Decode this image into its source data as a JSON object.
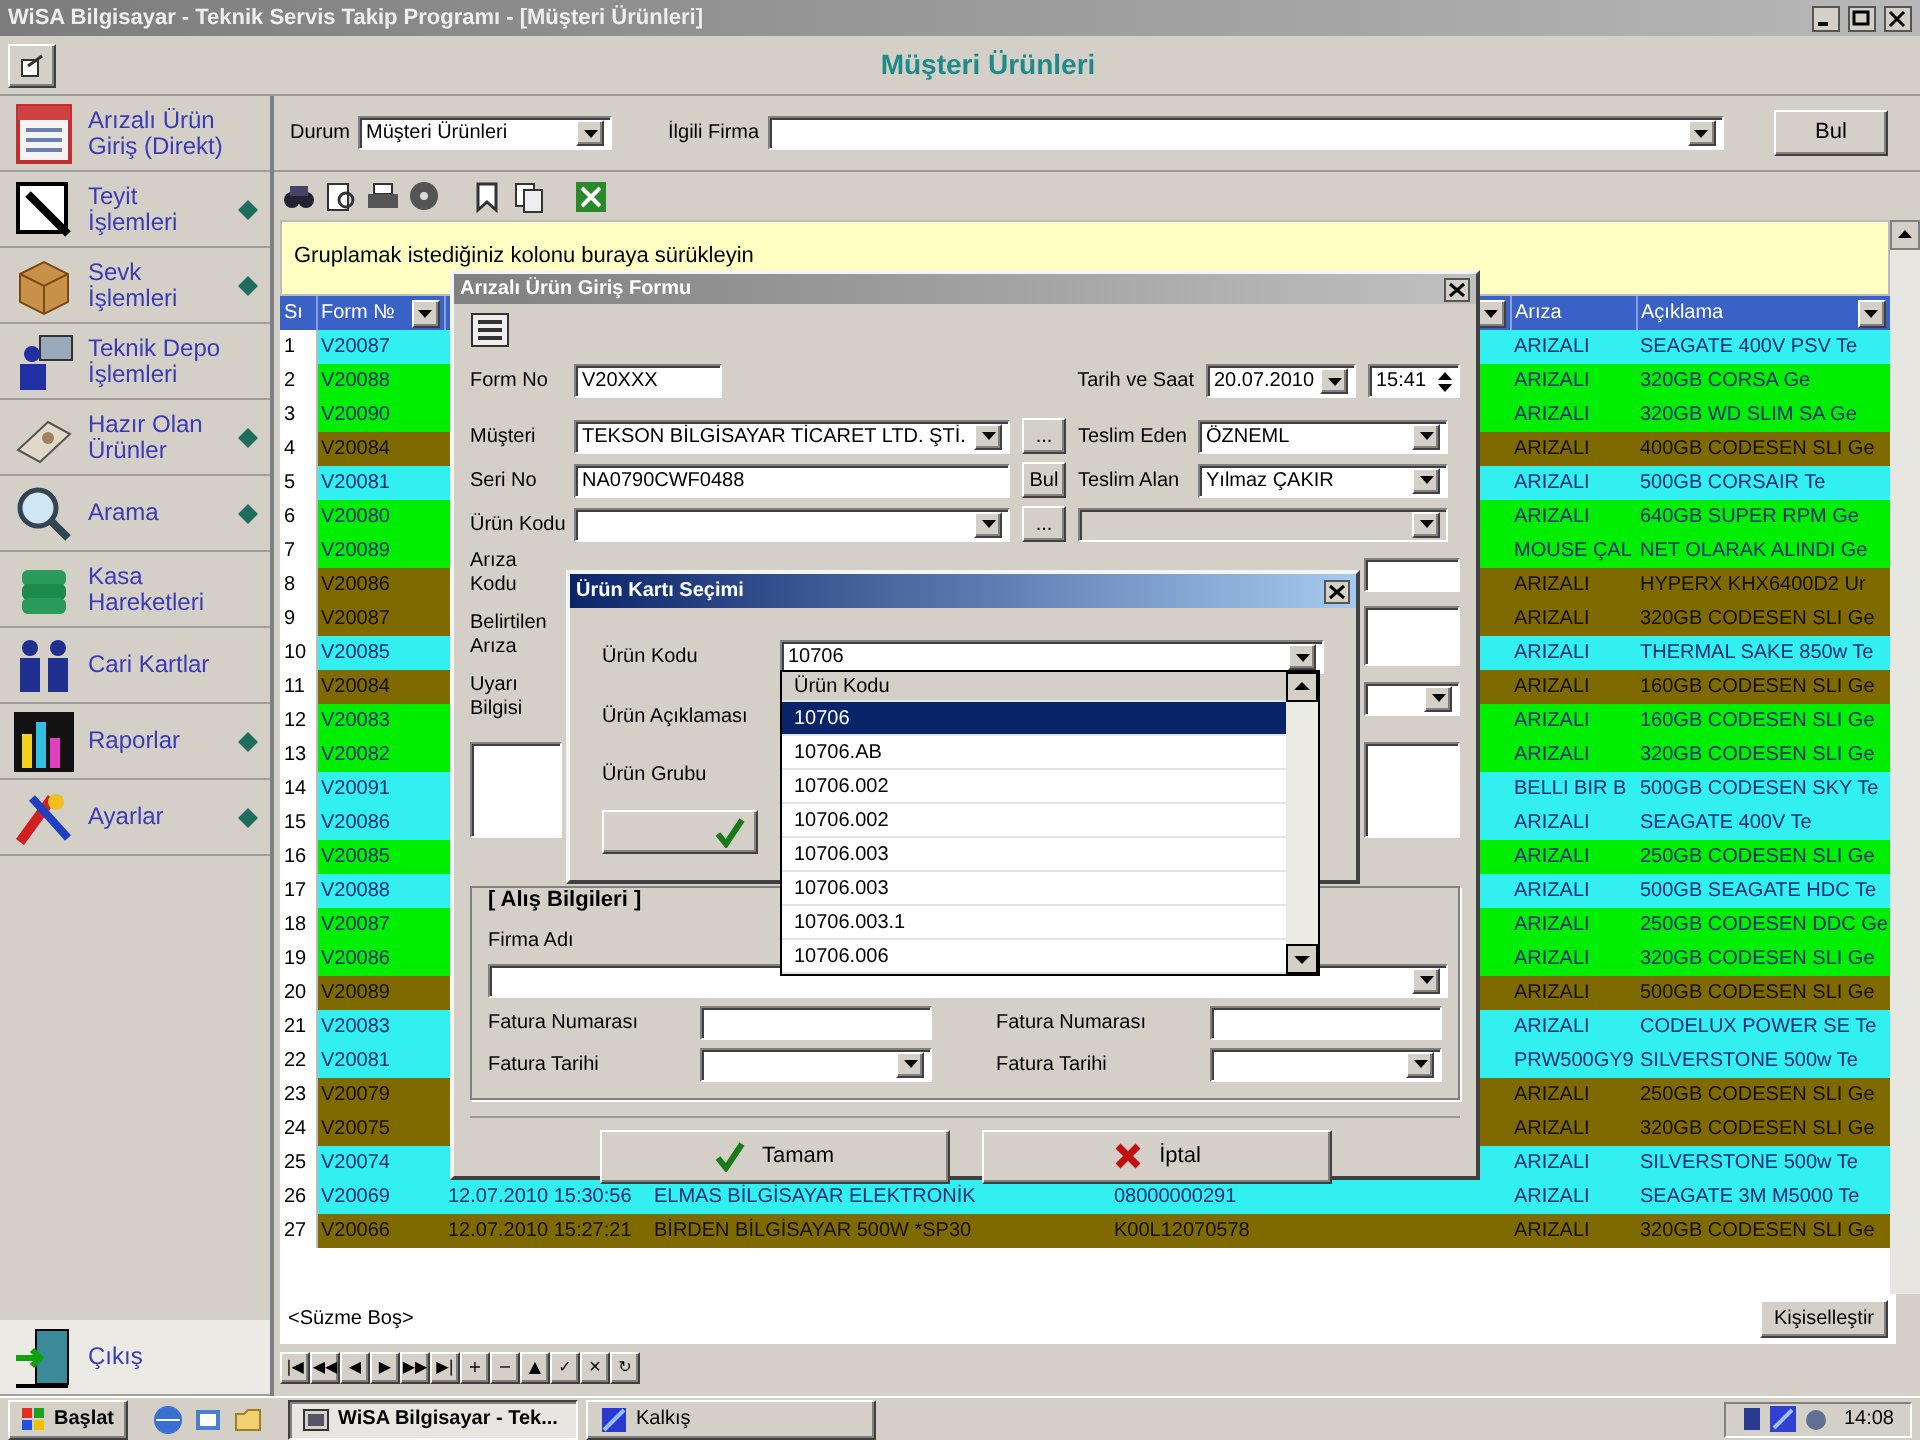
{
  "window": {
    "title": "WiSA Bilgisayar - Teknik Servis Takip Programı - [Müşteri Ürünleri]"
  },
  "header": {
    "title": "Müşteri Ürünleri"
  },
  "sidebar": {
    "items": [
      {
        "label": "Arızalı Ürün Giriş (Direkt)",
        "submenu": false
      },
      {
        "label": "Teyit İşlemleri",
        "submenu": true
      },
      {
        "label": "Sevk İşlemleri",
        "submenu": true
      },
      {
        "label": "Teknik Depo İşlemleri",
        "submenu": false
      },
      {
        "label": "Hazır Olan Ürünler",
        "submenu": true
      },
      {
        "label": "Arama",
        "submenu": true
      },
      {
        "label": "Kasa Hareketleri",
        "submenu": false
      },
      {
        "label": "Cari Kartlar",
        "submenu": false
      },
      {
        "label": "Raporlar",
        "submenu": true
      },
      {
        "label": "Ayarlar",
        "submenu": true
      }
    ],
    "exit": "Çıkış"
  },
  "filter": {
    "status_label": "Durum",
    "status_value": "Müşteri Ürünleri",
    "company_label": "İlgili Firma",
    "find_button": "Bul"
  },
  "group_panel": {
    "hint": "Gruplamak istediğiniz kolonu buraya sürükleyin"
  },
  "grid": {
    "columns": [
      {
        "label": "Sı",
        "filter": false
      },
      {
        "label": "Form №",
        "filter": true
      },
      {},
      {},
      {
        "filter": true
      },
      {
        "label": "Arıza",
        "filter": false
      },
      {
        "label": "Açıklama",
        "filter": true
      }
    ],
    "rows": [
      {
        "no": "1",
        "form_no": "V20087",
        "fault": "ARIZALI",
        "description": "SEAGATE 400V PSV Te",
        "color": "#33f0f0"
      },
      {
        "no": "2",
        "form_no": "V20088",
        "fault": "ARIZALI",
        "description": "320GB CORSA Ge",
        "color": "#00ee00"
      },
      {
        "no": "3",
        "form_no": "V20090",
        "fault": "ARIZALI",
        "description": "320GB WD SLIM SA Ge",
        "color": "#00ee00"
      },
      {
        "no": "4",
        "form_no": "V20084",
        "fault": "ARIZALI",
        "description": "400GB CODESEN SLI Ge",
        "color": "#7f6a00"
      },
      {
        "no": "5",
        "form_no": "V20081",
        "fault": "ARIZALI",
        "description": "500GB CORSAIR Te",
        "color": "#33f0f0"
      },
      {
        "no": "6",
        "form_no": "V20080",
        "fault": "ARIZALI",
        "description": "640GB SUPER RPM Ge",
        "color": "#00ee00"
      },
      {
        "no": "7",
        "form_no": "V20089",
        "fault": "MOUSE ÇAL",
        "description": "NET OLARAK ALINDI Ge",
        "color": "#00ee00"
      },
      {
        "no": "8",
        "form_no": "V20086",
        "fault": "ARIZALI",
        "description": "HYPERX KHX6400D2 Ur",
        "color": "#7f6a00"
      },
      {
        "no": "9",
        "form_no": "V20087",
        "fault": "ARIZALI",
        "description": "320GB CODESEN SLI Ge",
        "color": "#7f6a00"
      },
      {
        "no": "10",
        "form_no": "V20085",
        "fault": "ARIZALI",
        "description": "THERMAL SAKE 850w Te",
        "color": "#33f0f0"
      },
      {
        "no": "11",
        "form_no": "V20084",
        "fault": "ARIZALI",
        "description": "160GB CODESEN SLI Ge",
        "color": "#7f6a00"
      },
      {
        "no": "12",
        "form_no": "V20083",
        "fault": "ARIZALI",
        "description": "160GB CODESEN SLI Ge",
        "color": "#00ee00"
      },
      {
        "no": "13",
        "form_no": "V20082",
        "fault": "ARIZALI",
        "description": "320GB CODESEN SLI Ge",
        "color": "#00ee00"
      },
      {
        "no": "14",
        "form_no": "V20091",
        "fault": "BELLI BIR B",
        "description": "500GB CODESEN SKY Te",
        "color": "#33f0f0"
      },
      {
        "no": "15",
        "form_no": "V20086",
        "fault": "ARIZALI",
        "description": "SEAGATE 400V Te",
        "color": "#33f0f0"
      },
      {
        "no": "16",
        "form_no": "V20085",
        "fault": "ARIZALI",
        "description": "250GB CODESEN SLI Ge",
        "color": "#00ee00"
      },
      {
        "no": "17",
        "form_no": "V20088",
        "fault": "ARIZALI",
        "description": "500GB SEAGATE HDC Te",
        "color": "#33f0f0"
      },
      {
        "no": "18",
        "form_no": "V20087",
        "fault": "ARIZALI",
        "description": "250GB CODESEN DDC Ge",
        "color": "#00ee00"
      },
      {
        "no": "19",
        "form_no": "V20086",
        "fault": "ARIZALI",
        "description": "320GB CODESEN SLI Ge",
        "color": "#00ee00"
      },
      {
        "no": "20",
        "form_no": "V20089",
        "fault": "ARIZALI",
        "description": "500GB CODESEN SLI Ge",
        "color": "#7f6a00"
      },
      {
        "no": "21",
        "form_no": "V20083",
        "fault": "ARIZALI",
        "description": "CODELUX POWER SE Te",
        "color": "#33f0f0"
      },
      {
        "no": "22",
        "form_no": "V20081",
        "fault": "PRW500GY9",
        "description": "SILVERSTONE 500w Te",
        "color": "#33f0f0"
      },
      {
        "no": "23",
        "form_no": "V20079",
        "fault": "ARIZALI",
        "description": "250GB CODESEN SLI Ge",
        "color": "#7f6a00"
      },
      {
        "no": "24",
        "form_no": "V20075",
        "fault": "ARIZALI",
        "description": "320GB CODESEN SLI Ge",
        "color": "#7f6a00"
      },
      {
        "no": "25",
        "form_no": "V20074",
        "fault": "ARIZALI",
        "description": "SILVERSTONE 500w Te",
        "color": "#33f0f0"
      },
      {
        "no": "26",
        "form_no": "V20069",
        "date": "12.07.2010 15:30:56",
        "customer": "ELMAS BİLGİSAYAR ELEKTRONİK",
        "serial": "08000000291",
        "fault": "ARIZALI",
        "description": "SEAGATE 3M M5000 Te",
        "color": "#33f0f0"
      },
      {
        "no": "27",
        "form_no": "V20066",
        "date": "12.07.2010 15:27:21",
        "customer": "BİRDEN BİLGİSAYAR 500W *SP30",
        "serial": "K00L12070578",
        "fault": "ARIZALI",
        "description": "320GB CODESEN SLI Ge",
        "color": "#7f6a00"
      }
    ]
  },
  "filter_bar": {
    "text": "<Süzme Boş>",
    "customize_button": "Kişiselleştir"
  },
  "navigator": [
    "|◀",
    "◀◀",
    "◀",
    "▶",
    "▶▶",
    "▶|",
    "+",
    "−",
    "▲",
    "✓",
    "✕",
    "↻"
  ],
  "entry_dialog": {
    "title": "Arızalı Ürün Giriş Formu",
    "form_no": {
      "label": "Form No",
      "value": "V20XXX"
    },
    "date_time": {
      "label": "Tarih ve Saat",
      "date": "20.07.2010",
      "time": "15:41"
    },
    "customer": {
      "label": "Müşteri",
      "value": "TEKSON BİLGİSAYAR TİCARET LTD. ŞTİ.",
      "button": "..."
    },
    "delivered_by": {
      "label": "Teslim Eden",
      "value": "ÖZNEML"
    },
    "serial": {
      "label": "Seri No",
      "value": "NA0790CWF0488",
      "button": "Bul"
    },
    "received_by": {
      "label": "Teslim Alan",
      "value": "Yılmaz ÇAKIR"
    },
    "product_code": {
      "label": "Ürün Kodu",
      "button": "..."
    },
    "fault_code": {
      "label": "Arıza Kodu"
    },
    "stated_fault": {
      "label": "Belirtilen Arıza"
    },
    "warning": {
      "label": "Uyarı Bilgisi"
    },
    "purchase": {
      "legend": "[ Alış Bilgileri ]",
      "company_label": "Firma Adı",
      "invoice_no_labels": [
        "Fatura Numarası",
        "Fatura Numarası"
      ],
      "invoice_date_labels": [
        "Fatura Tarihi",
        "Fatura Tarihi"
      ]
    },
    "ok_button": "Tamam",
    "cancel_button": "İptal"
  },
  "product_dialog": {
    "title": "Ürün Kartı Seçimi",
    "code_label": "Ürün Kodu",
    "code_value": "10706",
    "description_label": "Ürün Açıklaması",
    "group_label": "Ürün Grubu",
    "dropdown": {
      "header": "Ürün Kodu",
      "items": [
        {
          "label": "10706",
          "selected": true
        },
        {
          "label": "10706.AB",
          "selected": false
        },
        {
          "label": "10706.002",
          "selected": false
        },
        {
          "label": "10706.002",
          "selected": false
        },
        {
          "label": "10706.003",
          "selected": false
        },
        {
          "label": "10706.003",
          "selected": false
        },
        {
          "label": "10706.003.1",
          "selected": false
        },
        {
          "label": "10706.006",
          "selected": false
        }
      ]
    }
  },
  "taskbar": {
    "start": "Başlat",
    "tasks": [
      {
        "label": "WiSA Bilgisayar - Tek...",
        "selected": true
      },
      {
        "label": "Kalkış",
        "selected": false
      }
    ],
    "clock": "14:08"
  }
}
